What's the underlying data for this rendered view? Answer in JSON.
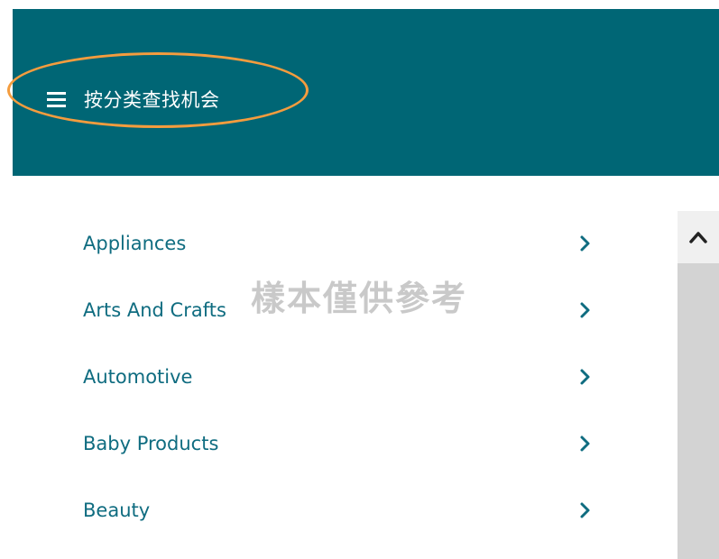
{
  "header": {
    "title": "按分类查找机会",
    "background_color": "#006675",
    "menu_icon": "hamburger-menu-icon"
  },
  "annotation": {
    "ring_color": "#f49c3e"
  },
  "categories": [
    {
      "label": "Appliances",
      "icon": "chevron-right-icon"
    },
    {
      "label": "Arts And Crafts",
      "icon": "chevron-right-icon"
    },
    {
      "label": "Automotive",
      "icon": "chevron-right-icon"
    },
    {
      "label": "Baby Products",
      "icon": "chevron-right-icon"
    },
    {
      "label": "Beauty",
      "icon": "chevron-right-icon"
    }
  ],
  "watermark": {
    "text": "樣本僅供參考"
  },
  "scrollbar": {
    "up_icon": "chevron-up-icon"
  },
  "colors": {
    "link": "#0f6c80",
    "watermark": "#c9c9c9",
    "scrollbar_track": "#d3d3d3"
  }
}
